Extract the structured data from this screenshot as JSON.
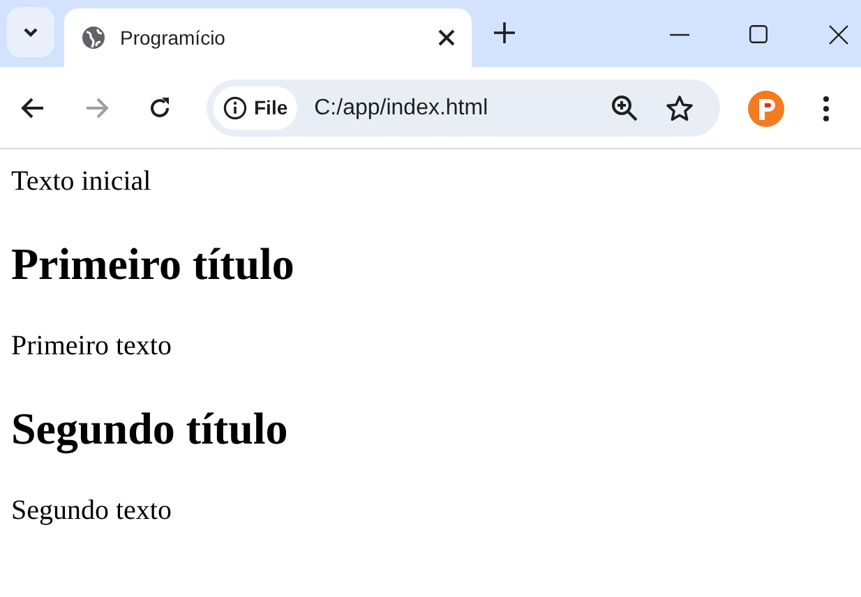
{
  "tab": {
    "title": "Programício",
    "selected": true
  },
  "address_bar": {
    "chip": "File",
    "url": "C:/app/index.html"
  },
  "content": [
    {
      "kind": "paragraph",
      "text": "Texto inicial"
    },
    {
      "kind": "heading",
      "text": "Primeiro título"
    },
    {
      "kind": "paragraph",
      "text": "Primeiro texto"
    },
    {
      "kind": "heading",
      "text": "Segundo título"
    },
    {
      "kind": "paragraph",
      "text": "Segundo texto"
    }
  ]
}
